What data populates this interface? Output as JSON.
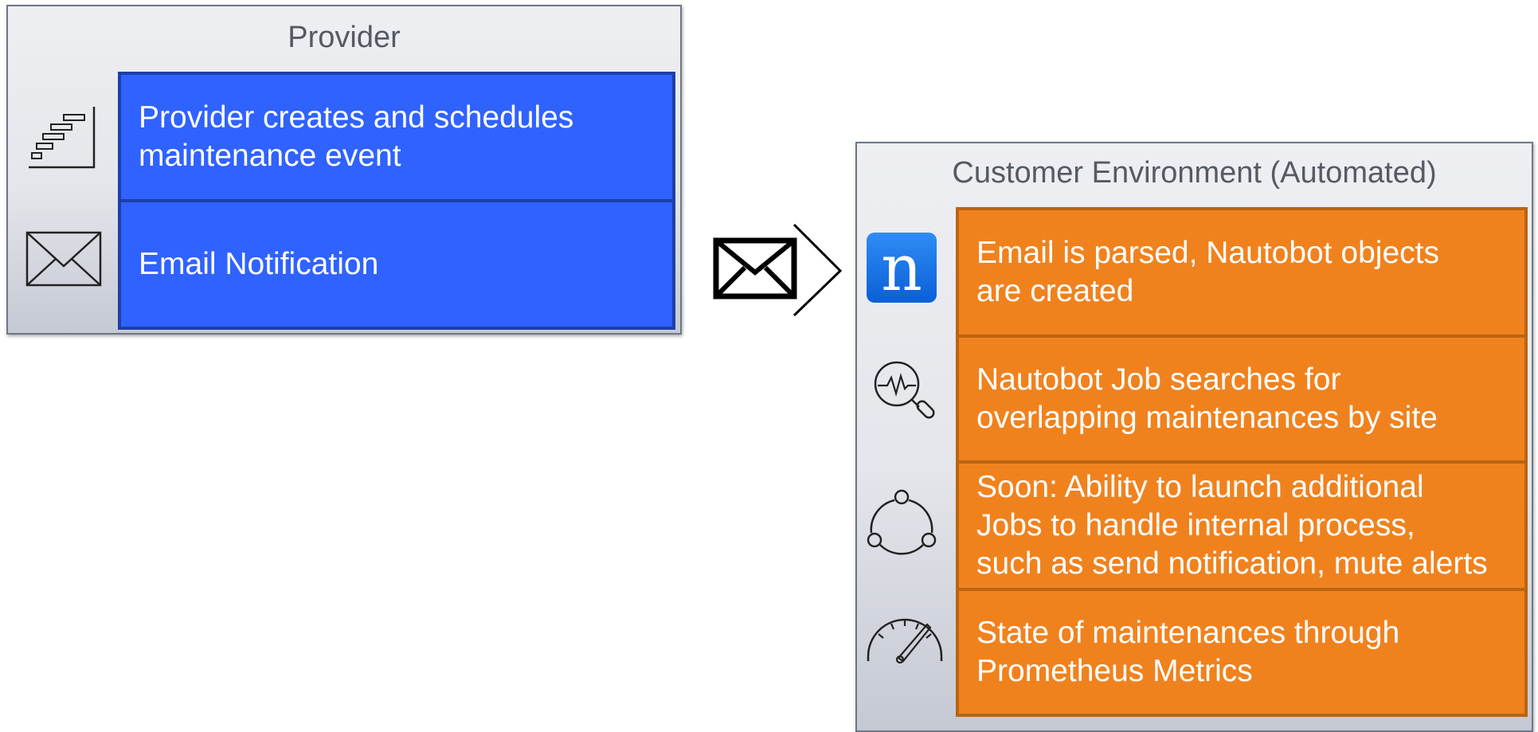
{
  "provider": {
    "title": "Provider",
    "steps": [
      {
        "label": "Provider creates and schedules\nmaintenance event",
        "icon": "gantt-schedule-icon"
      },
      {
        "label": "Email Notification",
        "icon": "envelope-icon"
      }
    ]
  },
  "connector": {
    "icon": "email-send-arrow-icon"
  },
  "customer": {
    "title": "Customer Environment (Automated)",
    "steps": [
      {
        "label": "Email is parsed, Nautobot objects\nare created",
        "icon": "nautobot-logo-icon",
        "logo_letter": "n"
      },
      {
        "label": "Nautobot Job searches for\noverlapping maintenances by site",
        "icon": "search-monitor-icon"
      },
      {
        "label": "Soon: Ability to launch additional\nJobs to handle internal process,\nsuch as send notification, mute alerts",
        "icon": "workflow-cycle-icon"
      },
      {
        "label": "State of maintenances through\nPrometheus Metrics",
        "icon": "gauge-icon"
      }
    ]
  },
  "colors": {
    "provider_step": "#3062ff",
    "customer_step": "#f0821e",
    "panel_title": "#555a64",
    "nautobot_logo": "#1a73e8"
  }
}
